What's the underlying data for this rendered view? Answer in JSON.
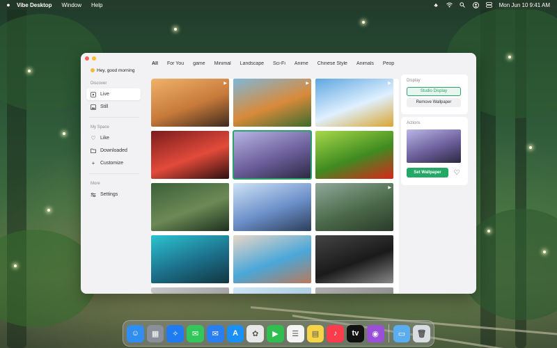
{
  "menubar": {
    "app_name": "Vibe Desktop",
    "menus": [
      "Window",
      "Help"
    ],
    "datetime": "Mon Jun 10  9:41 AM",
    "status_icons": [
      "app-status-icon",
      "wifi-icon",
      "search-icon",
      "user-icon",
      "control-center-icon"
    ]
  },
  "sidebar": {
    "greeting": "Hey, good morning",
    "discover_label": "Discover",
    "discover_items": [
      {
        "label": "Live",
        "icon": "play-icon"
      },
      {
        "label": "Still",
        "icon": "image-icon"
      }
    ],
    "myspace_label": "My Space",
    "myspace_items": [
      {
        "label": "Like",
        "icon": "heart-icon"
      },
      {
        "label": "Downloaded",
        "icon": "folder-icon"
      },
      {
        "label": "Customize",
        "icon": "plus-icon"
      }
    ],
    "more_label": "More",
    "more_items": [
      {
        "label": "Settings",
        "icon": "sliders-icon"
      }
    ]
  },
  "tabs": [
    "All",
    "For You",
    "game",
    "Minimal",
    "Landscape",
    "Sci-Fi",
    "Anime",
    "Chinese Style",
    "Animals",
    "Peop"
  ],
  "active_tab": "All",
  "grid": {
    "items": [
      {
        "name": "desert-sunset",
        "live": true,
        "colors": [
          "#f0b26a",
          "#c77a3a",
          "#3e2a1e"
        ]
      },
      {
        "name": "orange-house",
        "live": true,
        "colors": [
          "#7fb7d8",
          "#d98a3a",
          "#3a6b2f"
        ]
      },
      {
        "name": "sky-field",
        "live": true,
        "colors": [
          "#5ea6e0",
          "#dff0ff",
          "#d9a531"
        ]
      },
      {
        "name": "red-room-woman",
        "live": false,
        "colors": [
          "#7a1d1d",
          "#e34a3a",
          "#2e1010"
        ]
      },
      {
        "name": "anime-girls",
        "live": false,
        "selected": true,
        "colors": [
          "#b9b6e6",
          "#6c5f9c",
          "#2c2840"
        ]
      },
      {
        "name": "ladybugs",
        "live": false,
        "colors": [
          "#a7d84a",
          "#3f8b20",
          "#d8261c"
        ]
      },
      {
        "name": "forest-woman",
        "live": false,
        "colors": [
          "#3a5f3a",
          "#6c8a55",
          "#1e2f1e"
        ]
      },
      {
        "name": "anime-girl-lying",
        "live": false,
        "colors": [
          "#cfe3f6",
          "#6b8fc9",
          "#2c3e5a"
        ]
      },
      {
        "name": "misty-forest",
        "live": true,
        "colors": [
          "#8fa89a",
          "#4b6a4a",
          "#2a3a2a"
        ]
      },
      {
        "name": "lake-pier",
        "live": false,
        "colors": [
          "#2bc3d0",
          "#1c6f8a",
          "#12353f"
        ]
      },
      {
        "name": "woman-chair",
        "live": false,
        "colors": [
          "#e9d6c7",
          "#4aa7d9",
          "#b87a5c"
        ]
      },
      {
        "name": "dark-vortex",
        "live": false,
        "colors": [
          "#444444",
          "#1a1a1a",
          "#888888"
        ]
      },
      {
        "name": "row5-a",
        "live": false,
        "colors": [
          "#c9c9c9",
          "#9a9a9a",
          "#6a6a6a"
        ]
      },
      {
        "name": "row5-b",
        "live": false,
        "colors": [
          "#cfe6f5",
          "#a8c8e0",
          "#7fa0c0"
        ]
      },
      {
        "name": "row5-c",
        "live": false,
        "colors": [
          "#b0b0b0",
          "#8a8a8a",
          "#5a5a5a"
        ]
      }
    ]
  },
  "display": {
    "label": "Display",
    "studio_button": "Studio Display",
    "remove_button": "Remove Wallpaper"
  },
  "actions": {
    "label": "Actions",
    "set_button": "Set Wallpaper",
    "preview_colors": [
      "#b9b6e6",
      "#6c5f9c",
      "#2c2840"
    ]
  },
  "dock": {
    "apps": [
      {
        "name": "finder-icon",
        "glyph": "☺",
        "color": "#2f8ef0"
      },
      {
        "name": "launchpad-icon",
        "glyph": "▦",
        "color": "#8a8f9a"
      },
      {
        "name": "safari-icon",
        "glyph": "✧",
        "color": "#1e7cf0"
      },
      {
        "name": "messages-icon",
        "glyph": "✉",
        "color": "#33c759"
      },
      {
        "name": "mail-icon",
        "glyph": "✉",
        "color": "#2a7ff0"
      },
      {
        "name": "app-store-icon",
        "glyph": "A",
        "color": "#1a8ff5"
      },
      {
        "name": "photos-icon",
        "glyph": "✿",
        "color": "#e8e8e8"
      },
      {
        "name": "facetime-icon",
        "glyph": "▶",
        "color": "#2fbe4f"
      },
      {
        "name": "reminders-icon",
        "glyph": "☰",
        "color": "#f4f4f4"
      },
      {
        "name": "notes-icon",
        "glyph": "▤",
        "color": "#f5d547"
      },
      {
        "name": "music-icon",
        "glyph": "♪",
        "color": "#fa3c4c"
      },
      {
        "name": "tv-icon",
        "glyph": "tv",
        "color": "#111111"
      },
      {
        "name": "podcasts-icon",
        "glyph": "◉",
        "color": "#9a4fd8"
      }
    ],
    "right": [
      {
        "name": "downloads-folder-icon",
        "glyph": "▭",
        "color": "#5aaef0"
      },
      {
        "name": "trash-icon",
        "glyph": "🗑",
        "color": "#d8dde2"
      }
    ]
  }
}
